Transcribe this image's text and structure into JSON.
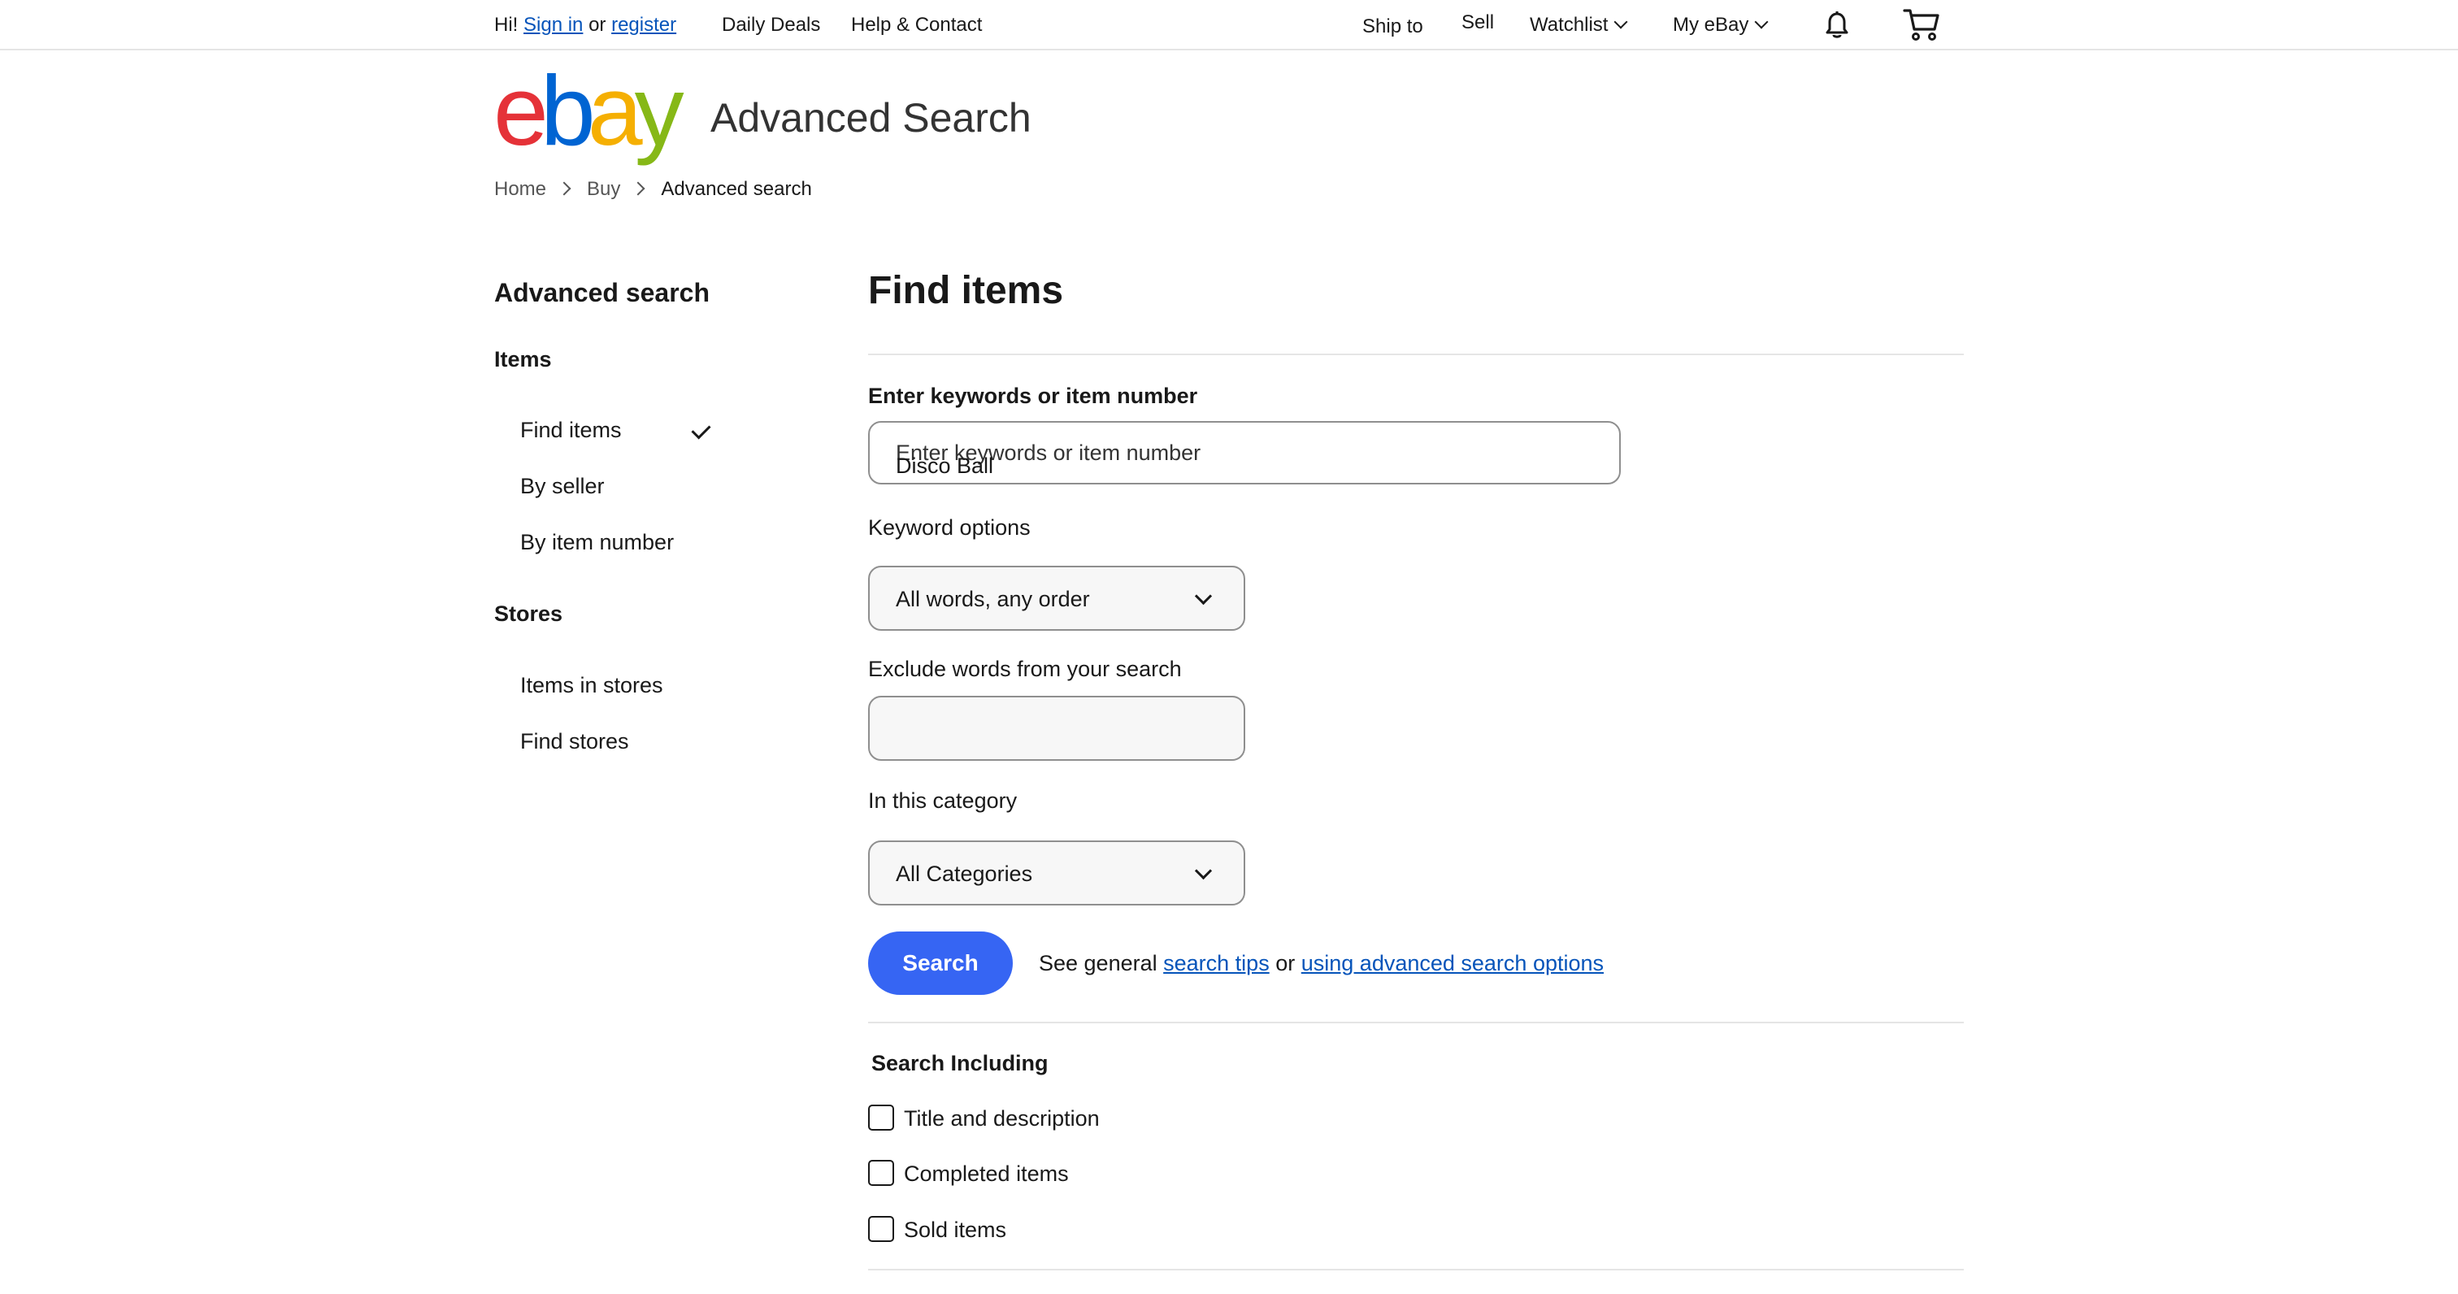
{
  "topnav": {
    "greeting": "Hi!",
    "sign_in": "Sign in",
    "or": "or",
    "register": "register",
    "daily_deals": "Daily Deals",
    "help_contact": "Help & Contact",
    "ship_to": "Ship to",
    "sell": "Sell",
    "watchlist": "Watchlist",
    "my_ebay": "My eBay",
    "icons": [
      "bell-icon",
      "cart-icon"
    ]
  },
  "header": {
    "logo_letters": [
      "e",
      "b",
      "a",
      "y"
    ],
    "logo_colors": [
      "#e53238",
      "#0064d2",
      "#f5af02",
      "#86b817"
    ],
    "title": "Advanced Search"
  },
  "breadcrumb": [
    "Home",
    "Buy",
    "Advanced search"
  ],
  "sidebar": {
    "title": "Advanced search",
    "items_heading": "Items",
    "items": [
      "Find items",
      "By seller",
      "By item number"
    ],
    "selected": "Find items",
    "stores_heading": "Stores",
    "stores": [
      "Items in stores",
      "Find stores"
    ]
  },
  "main": {
    "title": "Find items",
    "keywords_label": "Enter keywords or item number",
    "keywords_placeholder": "Enter keywords or item number",
    "keywords_value": "Disco Ball",
    "keyword_options_label": "Keyword options",
    "keyword_options_value": "All words, any order",
    "exclude_label": "Exclude words from your search",
    "exclude_value": "",
    "category_label": "In this category",
    "category_value": "All Categories",
    "search_button": "Search",
    "tips_prefix": "See general",
    "tips_link1": "search tips",
    "tips_or": "or",
    "tips_link2": "using advanced search options",
    "search_including_heading": "Search Including",
    "checkboxes": [
      {
        "label": "Title and description",
        "checked": false
      },
      {
        "label": "Completed items",
        "checked": false
      },
      {
        "label": "Sold items",
        "checked": false
      }
    ]
  },
  "colors": {
    "accent_button": "#3665f3",
    "link": "#0654ba"
  }
}
